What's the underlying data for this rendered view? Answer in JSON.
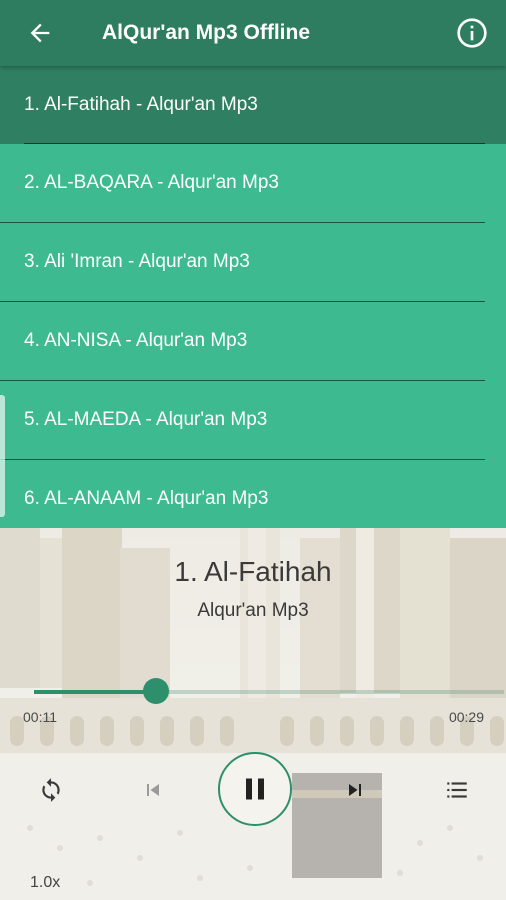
{
  "appbar": {
    "title": "AlQur'an Mp3 Offline",
    "back_icon": "arrow-left-icon",
    "info_icon": "info-icon",
    "color": "#2e7d61"
  },
  "list": {
    "color": "#3dba8f",
    "active_color": "#2f7f62",
    "items": [
      {
        "label": "1. Al-Fatihah - Alqur'an Mp3",
        "active": true
      },
      {
        "label": "2. AL-BAQARA - Alqur'an Mp3",
        "active": false
      },
      {
        "label": "3. Ali 'Imran - Alqur'an Mp3",
        "active": false
      },
      {
        "label": "4. AN-NISA - Alqur'an Mp3",
        "active": false
      },
      {
        "label": "5. AL-MAEDA - Alqur'an Mp3",
        "active": false
      },
      {
        "label": "6. AL-ANAAM - Alqur'an Mp3",
        "active": false
      }
    ]
  },
  "player": {
    "title": "1. Al-Fatihah",
    "subtitle": "Alqur'an Mp3",
    "elapsed": "00:11",
    "duration": "00:29",
    "progress_fraction": 0.26,
    "speed": "1.0x",
    "accent": "#2e8f6c",
    "controls": [
      "repeat-icon",
      "skip-previous-icon",
      "pause-icon",
      "skip-next-icon",
      "playlist-icon"
    ]
  }
}
